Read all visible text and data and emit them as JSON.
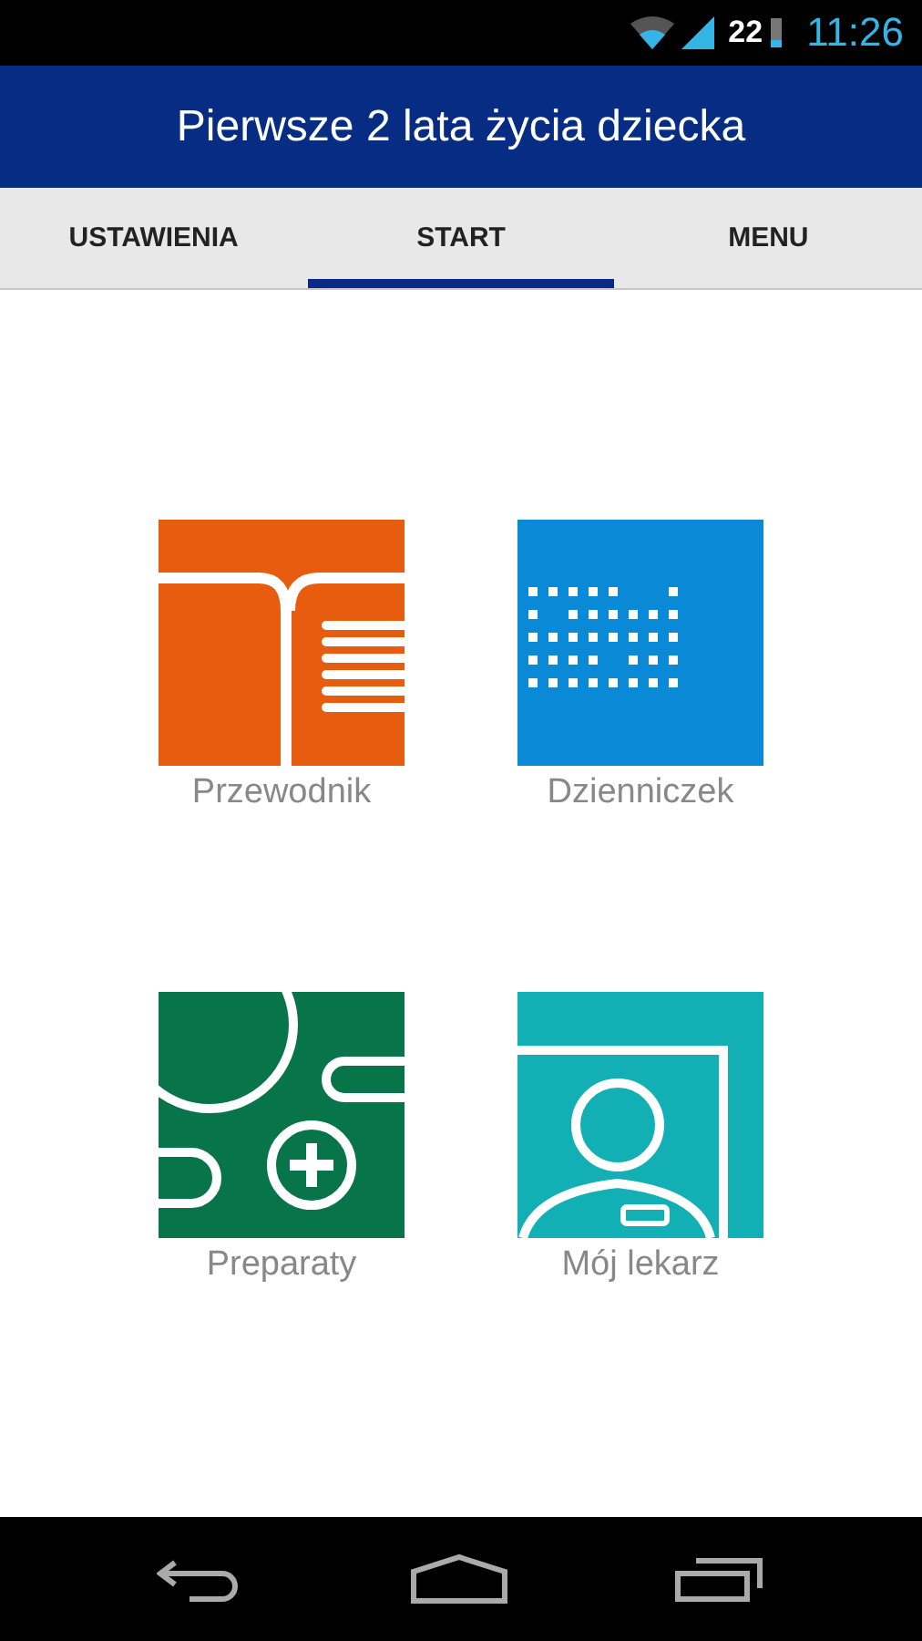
{
  "status_bar": {
    "battery": "22",
    "time": "11:26"
  },
  "header": {
    "title": "Pierwsze 2 lata życia dziecka"
  },
  "tabs": [
    {
      "label": "USTAWIENIA",
      "selected": false
    },
    {
      "label": "START",
      "selected": true
    },
    {
      "label": "MENU",
      "selected": false
    }
  ],
  "tiles": [
    {
      "kind": "book",
      "label": "Przewodnik",
      "color": "#e85c10"
    },
    {
      "kind": "calendar",
      "label": "Dzienniczek",
      "color": "#0a8ad6"
    },
    {
      "kind": "pills",
      "label": "Preparaty",
      "color": "#08744a"
    },
    {
      "kind": "doctor",
      "label": "Mój lekarz",
      "color": "#12b0b4"
    }
  ]
}
